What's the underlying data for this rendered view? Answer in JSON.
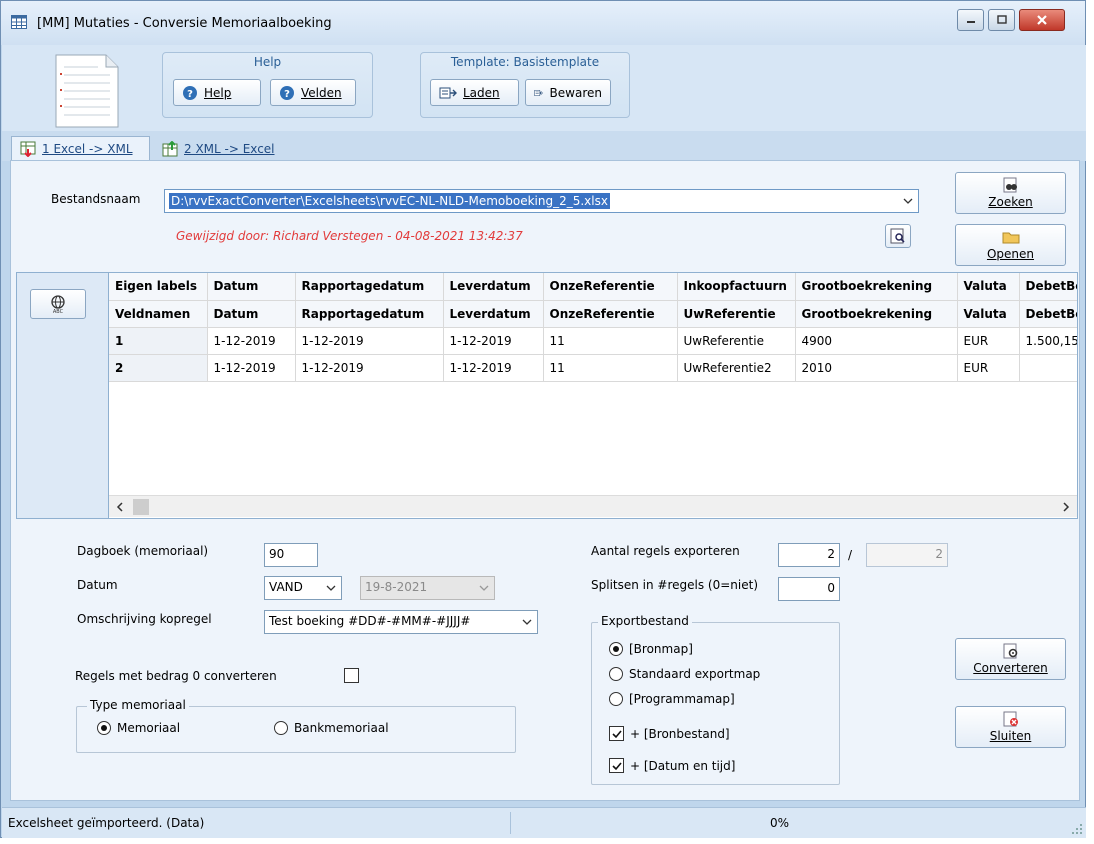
{
  "window": {
    "title": "[MM]  Mutaties - Conversie Memoriaalboeking"
  },
  "toolbar": {
    "help_group_title": "Help",
    "help_button": "Help",
    "fields_button": "Velden",
    "template_group_title": "Template: Basistemplate",
    "load_button": "Laden",
    "save_button": "Bewaren"
  },
  "tabs": [
    {
      "label": "1 Excel -> XML"
    },
    {
      "label": "2 XML -> Excel"
    }
  ],
  "file": {
    "label": "Bestandsnaam",
    "value": "D:\\rvvExactConverter\\Excelsheets\\rvvEC-NL-NLD-Memoboeking_2_5.xlsx",
    "modified": "Gewijzigd door: Richard Verstegen  -  04-08-2021  13:42:37",
    "search_button": "Zoeken",
    "open_button": "Openen"
  },
  "grid": {
    "columns": [
      "Eigen labels",
      "Datum",
      "Rapportagedatum",
      "Leverdatum",
      "OnzeReferentie",
      "Inkoopfactuurn",
      "Grootboekrekening",
      "Valuta",
      "DebetBe"
    ],
    "header_row_2": [
      "Veldnamen",
      "Datum",
      "Rapportagedatum",
      "Leverdatum",
      "OnzeReferentie",
      "UwReferentie",
      "Grootboekrekening",
      "Valuta",
      "DebetBe"
    ],
    "rows": [
      [
        "1",
        "1-12-2019",
        "1-12-2019",
        "1-12-2019",
        "11",
        "UwReferentie",
        "4900",
        "EUR",
        "1.500,15"
      ],
      [
        "2",
        "1-12-2019",
        "1-12-2019",
        "1-12-2019",
        "11",
        "UwReferentie2",
        "2010",
        "EUR",
        ""
      ]
    ]
  },
  "form": {
    "dagboek_label": "Dagboek (memoriaal)",
    "dagboek_value": "90",
    "datum_label": "Datum",
    "datum_mode": "VAND",
    "datum_value": "19-8-2021",
    "omschrijving_label": "Omschrijving kopregel",
    "omschrijving_value": "Test boeking #DD#-#MM#-#JJJJ#",
    "zero_label": "Regels met bedrag 0 converteren",
    "type_legend": "Type memoriaal",
    "type_memoriaal": "Memoriaal",
    "type_bank": "Bankmemoriaal",
    "aantal_label": "Aantal regels exporteren",
    "aantal_value": "2",
    "aantal_sep": "/",
    "aantal_total": "2",
    "splitsen_label": "Splitsen in #regels (0=niet)",
    "splitsen_value": "0",
    "export_legend": "Exportbestand",
    "export_bronmap": "[Bronmap]",
    "export_standaard": "Standaard exportmap",
    "export_programma": "[Programmamap]",
    "export_bronbestand": "+ [Bronbestand]",
    "export_datum": "+ [Datum en tijd]",
    "convert_button": "Converteren",
    "close_button": "Sluiten"
  },
  "status": {
    "message": "Excelsheet geïmporteerd. (Data)",
    "progress": "0%"
  }
}
